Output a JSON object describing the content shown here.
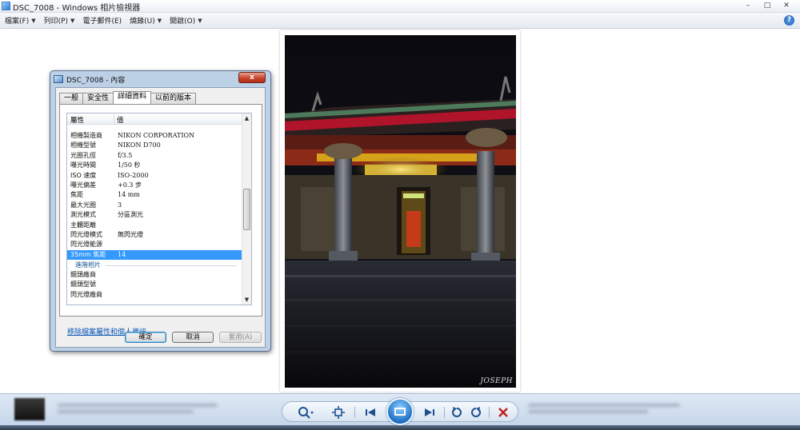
{
  "window": {
    "title": "DSC_7008 - Windows 相片檢視器",
    "controls": {
      "minimize": "–",
      "maximize": "□",
      "close": "✕"
    }
  },
  "menu": {
    "items": [
      {
        "label": "檔案(F)",
        "icon": "chevron-down-icon"
      },
      {
        "label": "列印(P)",
        "icon": "chevron-down-icon"
      },
      {
        "label": "電子郵件(E)"
      },
      {
        "label": "燒錄(U)",
        "icon": "chevron-down-icon"
      },
      {
        "label": "開啟(O)",
        "icon": "chevron-down-icon"
      }
    ],
    "help": "?"
  },
  "photo": {
    "signature": "JOSEPH"
  },
  "dialog": {
    "title": "DSC_7008 - 內容",
    "close": "x",
    "tabs": [
      "一般",
      "安全性",
      "詳細資料",
      "以前的版本"
    ],
    "active_tab": "詳細資料",
    "columns": {
      "property": "屬性",
      "value": "值"
    },
    "rows": [
      {
        "key": "相機製造商",
        "value": "NIKON CORPORATION"
      },
      {
        "key": "相機型號",
        "value": "NIKON D700"
      },
      {
        "key": "光圈孔徑",
        "value": "f/3.5"
      },
      {
        "key": "曝光時間",
        "value": "1/50 秒"
      },
      {
        "key": "ISO 速度",
        "value": "ISO-2000"
      },
      {
        "key": "曝光偏差",
        "value": "+0.3 步"
      },
      {
        "key": "焦距",
        "value": "14 mm"
      },
      {
        "key": "最大光圈",
        "value": "3"
      },
      {
        "key": "測光模式",
        "value": "分區測光"
      },
      {
        "key": "主體距離",
        "value": ""
      },
      {
        "key": "閃光燈模式",
        "value": "無閃光燈"
      },
      {
        "key": "閃光燈能源",
        "value": ""
      },
      {
        "key": "35mm 焦距",
        "value": "14",
        "selected": true
      }
    ],
    "section": "進階相片",
    "rows2": [
      {
        "key": "鏡頭廠商",
        "value": ""
      },
      {
        "key": "鏡頭型號",
        "value": ""
      },
      {
        "key": "閃光燈廠商",
        "value": ""
      }
    ],
    "remove_link": "移除檔案屬性和個人資訊",
    "buttons": {
      "ok": "確定",
      "cancel": "取消",
      "apply": "套用(A)"
    }
  },
  "bottom_controls": {
    "zoom": "magnifier-icon",
    "fit": "fit-window-icon",
    "prev": "previous-icon",
    "slideshow": "slideshow-icon",
    "next": "next-icon",
    "rotate_ccw": "rotate-ccw-icon",
    "rotate_cw": "rotate-cw-icon",
    "delete": "delete-icon"
  }
}
